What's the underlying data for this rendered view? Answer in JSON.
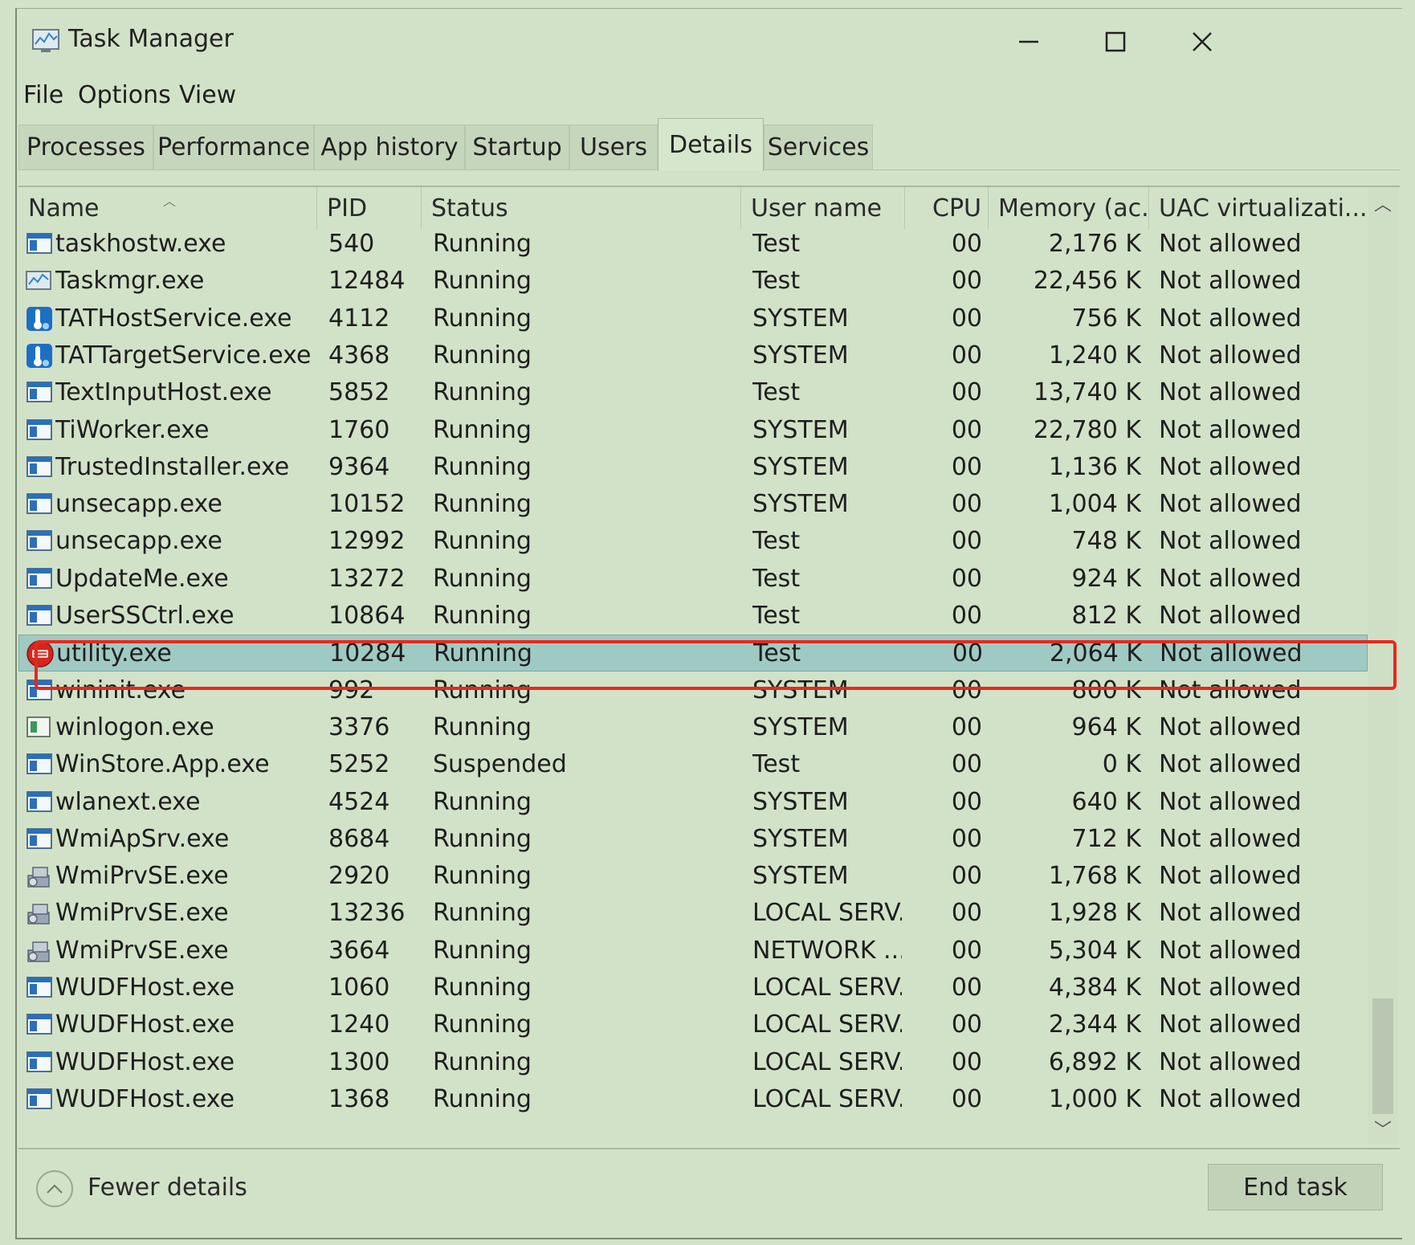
{
  "window": {
    "title": "Task Manager"
  },
  "menu": [
    "File",
    "Options",
    "View"
  ],
  "tabs": [
    {
      "label": "Processes"
    },
    {
      "label": "Performance"
    },
    {
      "label": "App history"
    },
    {
      "label": "Startup"
    },
    {
      "label": "Users"
    },
    {
      "label": "Details",
      "active": true
    },
    {
      "label": "Services"
    }
  ],
  "columns": [
    "Name",
    "PID",
    "Status",
    "User name",
    "CPU",
    "Memory (ac...",
    "UAC virtualizati..."
  ],
  "rows": [
    {
      "icon": "window-icon",
      "name": "taskhostw.exe",
      "pid": "540",
      "status": "Running",
      "user": "Test",
      "cpu": "00",
      "memory": "2,176 K",
      "uac": "Not allowed"
    },
    {
      "icon": "taskmgr-icon",
      "name": "Taskmgr.exe",
      "pid": "12484",
      "status": "Running",
      "user": "Test",
      "cpu": "00",
      "memory": "22,456 K",
      "uac": "Not allowed"
    },
    {
      "icon": "intel-service-icon",
      "name": "TATHostService.exe",
      "pid": "4112",
      "status": "Running",
      "user": "SYSTEM",
      "cpu": "00",
      "memory": "756 K",
      "uac": "Not allowed"
    },
    {
      "icon": "intel-service-icon",
      "name": "TATTargetService.exe",
      "pid": "4368",
      "status": "Running",
      "user": "SYSTEM",
      "cpu": "00",
      "memory": "1,240 K",
      "uac": "Not allowed"
    },
    {
      "icon": "window-icon",
      "name": "TextInputHost.exe",
      "pid": "5852",
      "status": "Running",
      "user": "Test",
      "cpu": "00",
      "memory": "13,740 K",
      "uac": "Not allowed"
    },
    {
      "icon": "window-icon",
      "name": "TiWorker.exe",
      "pid": "1760",
      "status": "Running",
      "user": "SYSTEM",
      "cpu": "00",
      "memory": "22,780 K",
      "uac": "Not allowed"
    },
    {
      "icon": "window-icon",
      "name": "TrustedInstaller.exe",
      "pid": "9364",
      "status": "Running",
      "user": "SYSTEM",
      "cpu": "00",
      "memory": "1,136 K",
      "uac": "Not allowed"
    },
    {
      "icon": "window-icon",
      "name": "unsecapp.exe",
      "pid": "10152",
      "status": "Running",
      "user": "SYSTEM",
      "cpu": "00",
      "memory": "1,004 K",
      "uac": "Not allowed"
    },
    {
      "icon": "window-icon",
      "name": "unsecapp.exe",
      "pid": "12992",
      "status": "Running",
      "user": "Test",
      "cpu": "00",
      "memory": "748 K",
      "uac": "Not allowed"
    },
    {
      "icon": "window-icon",
      "name": "UpdateMe.exe",
      "pid": "13272",
      "status": "Running",
      "user": "Test",
      "cpu": "00",
      "memory": "924 K",
      "uac": "Not allowed"
    },
    {
      "icon": "window-icon",
      "name": "UserSSCtrl.exe",
      "pid": "10864",
      "status": "Running",
      "user": "Test",
      "cpu": "00",
      "memory": "812 K",
      "uac": "Not allowed"
    },
    {
      "icon": "utility-red-icon",
      "name": "utility.exe",
      "pid": "10284",
      "status": "Running",
      "user": "Test",
      "cpu": "00",
      "memory": "2,064 K",
      "uac": "Not allowed",
      "selected": true
    },
    {
      "icon": "window-icon",
      "name": "wininit.exe",
      "pid": "992",
      "status": "Running",
      "user": "SYSTEM",
      "cpu": "00",
      "memory": "800 K",
      "uac": "Not allowed"
    },
    {
      "icon": "winlogon-icon",
      "name": "winlogon.exe",
      "pid": "3376",
      "status": "Running",
      "user": "SYSTEM",
      "cpu": "00",
      "memory": "964 K",
      "uac": "Not allowed"
    },
    {
      "icon": "window-icon",
      "name": "WinStore.App.exe",
      "pid": "5252",
      "status": "Suspended",
      "user": "Test",
      "cpu": "00",
      "memory": "0 K",
      "uac": "Not allowed"
    },
    {
      "icon": "window-icon",
      "name": "wlanext.exe",
      "pid": "4524",
      "status": "Running",
      "user": "SYSTEM",
      "cpu": "00",
      "memory": "640 K",
      "uac": "Not allowed"
    },
    {
      "icon": "window-icon",
      "name": "WmiApSrv.exe",
      "pid": "8684",
      "status": "Running",
      "user": "SYSTEM",
      "cpu": "00",
      "memory": "712 K",
      "uac": "Not allowed"
    },
    {
      "icon": "wmi-provider-icon",
      "name": "WmiPrvSE.exe",
      "pid": "2920",
      "status": "Running",
      "user": "SYSTEM",
      "cpu": "00",
      "memory": "1,768 K",
      "uac": "Not allowed"
    },
    {
      "icon": "wmi-provider-icon",
      "name": "WmiPrvSE.exe",
      "pid": "13236",
      "status": "Running",
      "user": "LOCAL SERV...",
      "cpu": "00",
      "memory": "1,928 K",
      "uac": "Not allowed"
    },
    {
      "icon": "wmi-provider-icon",
      "name": "WmiPrvSE.exe",
      "pid": "3664",
      "status": "Running",
      "user": "NETWORK ...",
      "cpu": "00",
      "memory": "5,304 K",
      "uac": "Not allowed"
    },
    {
      "icon": "window-icon",
      "name": "WUDFHost.exe",
      "pid": "1060",
      "status": "Running",
      "user": "LOCAL SERV...",
      "cpu": "00",
      "memory": "4,384 K",
      "uac": "Not allowed"
    },
    {
      "icon": "window-icon",
      "name": "WUDFHost.exe",
      "pid": "1240",
      "status": "Running",
      "user": "LOCAL SERV...",
      "cpu": "00",
      "memory": "2,344 K",
      "uac": "Not allowed"
    },
    {
      "icon": "window-icon",
      "name": "WUDFHost.exe",
      "pid": "1300",
      "status": "Running",
      "user": "LOCAL SERV...",
      "cpu": "00",
      "memory": "6,892 K",
      "uac": "Not allowed"
    },
    {
      "icon": "window-icon",
      "name": "WUDFHost.exe",
      "pid": "1368",
      "status": "Running",
      "user": "LOCAL SERV...",
      "cpu": "00",
      "memory": "1,000 K",
      "uac": "Not allowed"
    }
  ],
  "footer": {
    "fewer_details": "Fewer details",
    "end_task": "End task"
  },
  "colors": {
    "background": "#d2e2c8",
    "selected_row": "#9fcac3",
    "highlight_border": "#e8281d"
  }
}
